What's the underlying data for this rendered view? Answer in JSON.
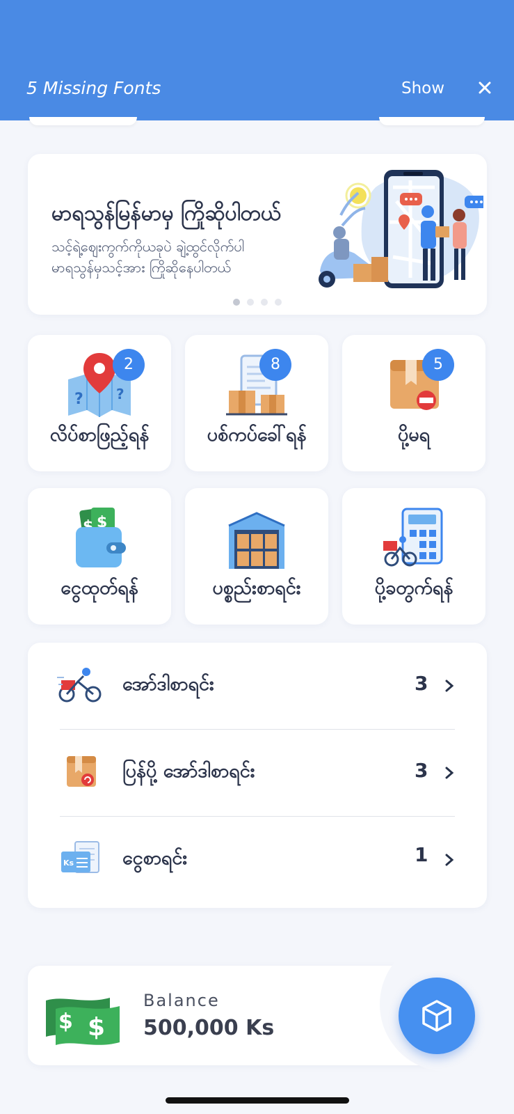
{
  "notice": {
    "title": "5 Missing Fonts",
    "show_label": "Show"
  },
  "banner": {
    "heading": "မာရသွန်မြန်မာမှ ကြိုဆိုပါတယ်",
    "line1": "သင့်ရဲ့ဈေးကွက်ကိုယခုပဲ ချဲ့ထွင်လိုက်ပါ",
    "line2": "မာရသွန်မှသင့်အား ကြိုဆိုနေပါတယ်",
    "page_count": 4,
    "active_page": 1
  },
  "tiles": [
    {
      "label": "လိပ်စာဖြည့်ရန်",
      "badge": "2",
      "icon": "map-pin-icon"
    },
    {
      "label": "ပစ်ကပ်ခေါ်ရန်",
      "badge": "8",
      "icon": "parcel-pickup-icon"
    },
    {
      "label": "ပို့မရ",
      "badge": "5",
      "icon": "undeliverable-box-icon"
    },
    {
      "label": "ငွေထုတ်ရန်",
      "badge": "",
      "icon": "wallet-icon"
    },
    {
      "label": "ပစ္စည်းစာရင်း",
      "badge": "",
      "icon": "warehouse-icon"
    },
    {
      "label": "ပို့ခတွက်ရန်",
      "badge": "",
      "icon": "delivery-calculator-icon"
    }
  ],
  "list": [
    {
      "label": "အော်ဒါစာရင်း",
      "count": "3",
      "icon": "delivery-bike-icon"
    },
    {
      "label": "ပြန်ပို့ အော်ဒါစာရင်း",
      "count": "3",
      "icon": "return-box-icon"
    },
    {
      "label": "ငွေစာရင်း",
      "count": "1",
      "icon": "ks-receipt-icon"
    }
  ],
  "balance": {
    "label": "Balance",
    "value": "500,000 Ks"
  },
  "colors": {
    "primary": "#4a8ae4",
    "badge": "#3d86ee",
    "text": "#2c344b",
    "background": "#f4f6fb"
  }
}
